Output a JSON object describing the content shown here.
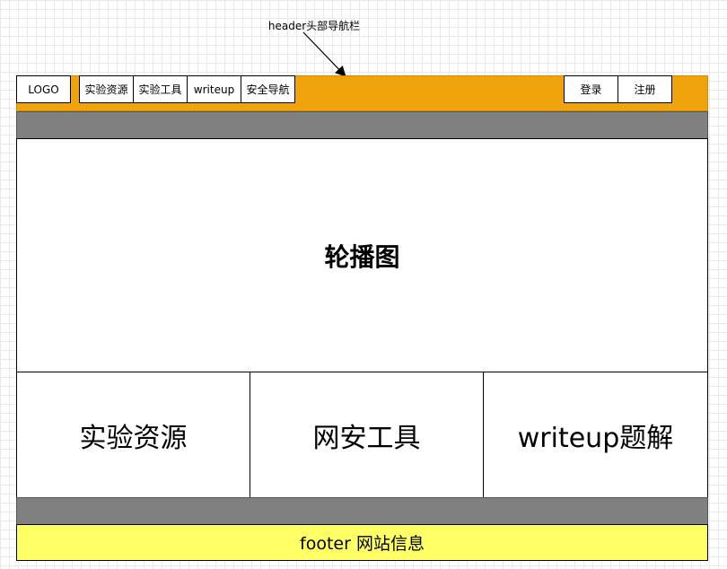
{
  "annotation": {
    "text": "header头部导航栏"
  },
  "header": {
    "logo": "LOGO",
    "nav": [
      "实验资源",
      "实验工具",
      "writeup",
      "安全导航"
    ],
    "login": "登录",
    "register": "注册"
  },
  "carousel": {
    "label": "轮播图"
  },
  "cards": [
    "实验资源",
    "网安工具",
    "writeup题解"
  ],
  "footer": {
    "text": "footer 网站信息"
  },
  "colors": {
    "header": "#f0a30a",
    "bar": "#808080",
    "footer": "#ffff66"
  }
}
